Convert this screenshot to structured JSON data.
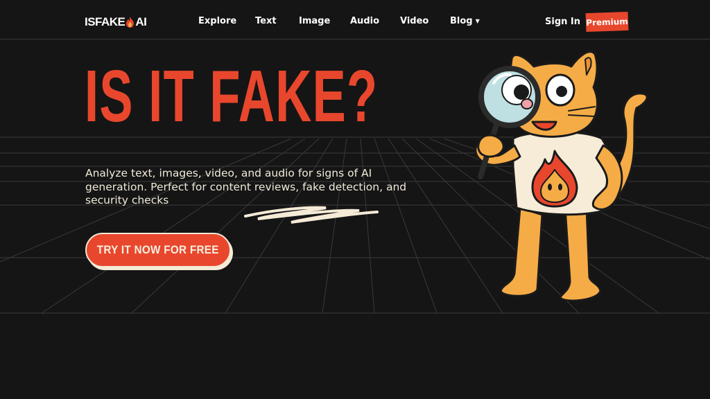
{
  "brand": {
    "logo_left": "ISFAKE",
    "logo_right": "AI",
    "logo_icon": "flame-icon"
  },
  "nav": {
    "items": [
      {
        "label": "Explore"
      },
      {
        "label": "Text"
      },
      {
        "label": "Image"
      },
      {
        "label": "Audio"
      },
      {
        "label": "Video"
      },
      {
        "label": "Blog"
      }
    ],
    "blog_caret": "▼",
    "sign_in": "Sign In",
    "premium": "Premium"
  },
  "hero": {
    "headline": "IS IT FAKE?",
    "subtitle": "Analyze text, images, video, and audio for signs of AI generation. Perfect for content reviews, fake detection, and security checks",
    "cta": "TRY IT NOW FOR FREE",
    "mascot": "cat-with-magnifying-glass-illustration"
  },
  "colors": {
    "background": "#151515",
    "accent": "#e8472d",
    "cream": "#f4ead6",
    "cat_orange": "#f5ac47"
  }
}
